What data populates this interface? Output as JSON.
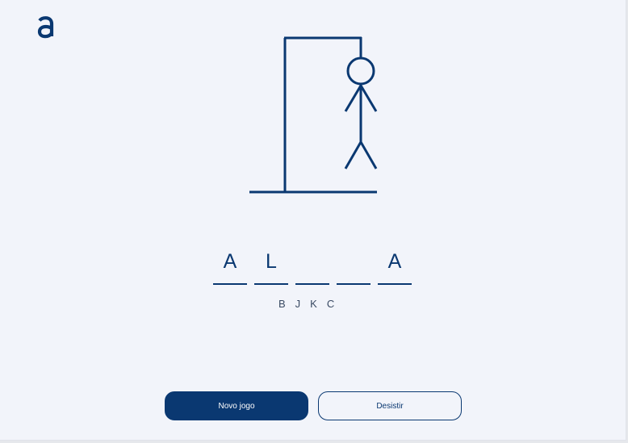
{
  "logo": {
    "icon": "alura-a-logo-icon",
    "color": "#0a3871"
  },
  "game": {
    "word_slots": [
      {
        "letter": "A"
      },
      {
        "letter": "L"
      },
      {
        "letter": ""
      },
      {
        "letter": ""
      },
      {
        "letter": "A"
      }
    ],
    "wrong_letters": [
      "B",
      "J",
      "K",
      "C"
    ]
  },
  "buttons": {
    "new_game": "Novo jogo",
    "give_up": "Desistir"
  },
  "colors": {
    "primary": "#0a3871",
    "background": "#f2f4fa"
  }
}
